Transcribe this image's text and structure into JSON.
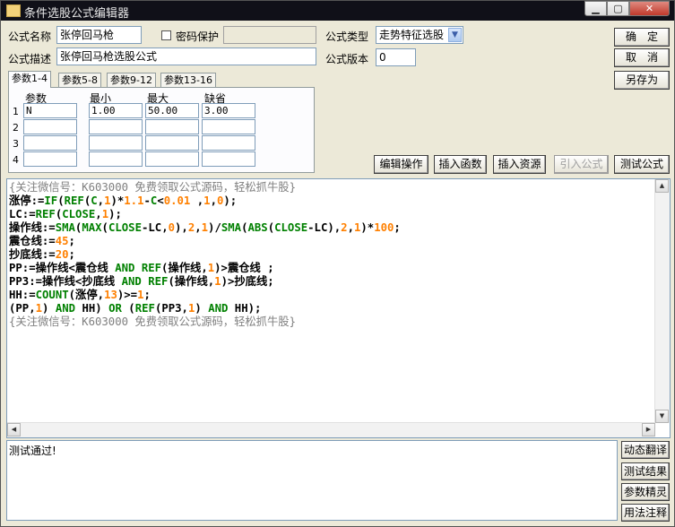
{
  "window": {
    "title": "条件选股公式编辑器",
    "min_glyph": "▁",
    "max_glyph": "▢",
    "close_glyph": "✕"
  },
  "form": {
    "name_label": "公式名称",
    "name_value": "张停回马枪",
    "password_label": "密码保护",
    "password_checked": false,
    "password_value": "",
    "type_label": "公式类型",
    "type_value": "走势特征选股",
    "desc_label": "公式描述",
    "desc_value": "张停回马枪选股公式",
    "version_label": "公式版本",
    "version_value": "0"
  },
  "buttons": {
    "confirm": "确　定",
    "cancel": "取　消",
    "save_as": "另存为",
    "edit_ops": "编辑操作",
    "insert_func": "插入函数",
    "insert_res": "插入资源",
    "import_formula": "引入公式",
    "test_formula": "测试公式"
  },
  "tabs": [
    "参数1-4",
    "参数5-8",
    "参数9-12",
    "参数13-16"
  ],
  "params": {
    "headers": [
      "参数",
      "最小",
      "最大",
      "缺省"
    ],
    "rows": [
      {
        "n": "1",
        "name": "N",
        "min": "1.00",
        "max": "50.00",
        "default": "3.00"
      },
      {
        "n": "2",
        "name": "",
        "min": "",
        "max": "",
        "default": ""
      },
      {
        "n": "3",
        "name": "",
        "min": "",
        "max": "",
        "default": ""
      },
      {
        "n": "4",
        "name": "",
        "min": "",
        "max": "",
        "default": ""
      }
    ]
  },
  "code_lines": [
    [
      [
        "cm",
        "{关注微信号：K603000 免费领取公式源码，轻松抓牛股}"
      ]
    ],
    [
      [
        "tx",
        "涨停:="
      ],
      [
        "fn",
        "IF"
      ],
      [
        "tx",
        "("
      ],
      [
        "fn",
        "REF"
      ],
      [
        "tx",
        "("
      ],
      [
        "fn",
        "C"
      ],
      [
        "tx",
        ","
      ],
      [
        "num",
        "1"
      ],
      [
        "tx",
        ")*"
      ],
      [
        "num",
        "1.1"
      ],
      [
        "tx",
        "-"
      ],
      [
        "fn",
        "C"
      ],
      [
        "tx",
        "<"
      ],
      [
        "num",
        "0.01"
      ],
      [
        "tx",
        " ,"
      ],
      [
        "num",
        "1"
      ],
      [
        "tx",
        ","
      ],
      [
        "num",
        "0"
      ],
      [
        "tx",
        ");"
      ]
    ],
    [
      [
        "tx",
        "LC:="
      ],
      [
        "fn",
        "REF"
      ],
      [
        "tx",
        "("
      ],
      [
        "fn",
        "CLOSE"
      ],
      [
        "tx",
        ","
      ],
      [
        "num",
        "1"
      ],
      [
        "tx",
        ");"
      ]
    ],
    [
      [
        "tx",
        "操作线:="
      ],
      [
        "fn",
        "SMA"
      ],
      [
        "tx",
        "("
      ],
      [
        "fn",
        "MAX"
      ],
      [
        "tx",
        "("
      ],
      [
        "fn",
        "CLOSE"
      ],
      [
        "tx",
        "-LC,"
      ],
      [
        "num",
        "0"
      ],
      [
        "tx",
        "),"
      ],
      [
        "num",
        "2"
      ],
      [
        "tx",
        ","
      ],
      [
        "num",
        "1"
      ],
      [
        "tx",
        ")/"
      ],
      [
        "fn",
        "SMA"
      ],
      [
        "tx",
        "("
      ],
      [
        "fn",
        "ABS"
      ],
      [
        "tx",
        "("
      ],
      [
        "fn",
        "CLOSE"
      ],
      [
        "tx",
        "-LC),"
      ],
      [
        "num",
        "2"
      ],
      [
        "tx",
        ","
      ],
      [
        "num",
        "1"
      ],
      [
        "tx",
        ")*"
      ],
      [
        "num",
        "100"
      ],
      [
        "tx",
        ";"
      ]
    ],
    [
      [
        "tx",
        "震仓线:="
      ],
      [
        "num",
        "45"
      ],
      [
        "tx",
        ";"
      ]
    ],
    [
      [
        "tx",
        "抄底线:="
      ],
      [
        "num",
        "20"
      ],
      [
        "tx",
        ";"
      ]
    ],
    [
      [
        "tx",
        "PP:=操作线<震仓线 "
      ],
      [
        "fn",
        "AND"
      ],
      [
        "tx",
        " "
      ],
      [
        "fn",
        "REF"
      ],
      [
        "tx",
        "(操作线,"
      ],
      [
        "num",
        "1"
      ],
      [
        "tx",
        ")>震仓线 ;"
      ]
    ],
    [
      [
        "tx",
        "PP3:=操作线<抄底线 "
      ],
      [
        "fn",
        "AND"
      ],
      [
        "tx",
        " "
      ],
      [
        "fn",
        "REF"
      ],
      [
        "tx",
        "(操作线,"
      ],
      [
        "num",
        "1"
      ],
      [
        "tx",
        ")>抄底线;"
      ]
    ],
    [
      [
        "tx",
        "HH:="
      ],
      [
        "fn",
        "COUNT"
      ],
      [
        "tx",
        "(涨停,"
      ],
      [
        "num",
        "13"
      ],
      [
        "tx",
        ")>="
      ],
      [
        "num",
        "1"
      ],
      [
        "tx",
        ";"
      ]
    ],
    [
      [
        "tx",
        "(PP,"
      ],
      [
        "num",
        "1"
      ],
      [
        "tx",
        ") "
      ],
      [
        "fn",
        "AND"
      ],
      [
        "tx",
        " HH) "
      ],
      [
        "fn",
        "OR"
      ],
      [
        "tx",
        " ("
      ],
      [
        "fn",
        "REF"
      ],
      [
        "tx",
        "(PP3,"
      ],
      [
        "num",
        "1"
      ],
      [
        "tx",
        ") "
      ],
      [
        "fn",
        "AND"
      ],
      [
        "tx",
        " HH);"
      ]
    ],
    [
      [
        "cm",
        "{关注微信号：K603000 免费领取公式源码，轻松抓牛股}"
      ]
    ]
  ],
  "output_text": "测试通过!",
  "side_buttons": [
    "动态翻译",
    "测试结果",
    "参数精灵",
    "用法注释"
  ]
}
